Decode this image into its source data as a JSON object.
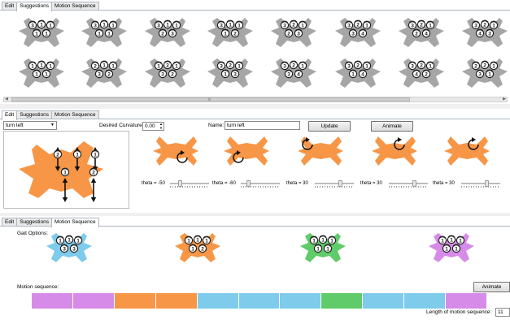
{
  "colors": {
    "gray": "#a6a6a6",
    "orange": "#f79646",
    "blue": "#7ecbec",
    "green": "#60cb6a",
    "purple": "#d78be8",
    "badge": "#222222"
  },
  "suggestions_panel": {
    "tabs": [
      {
        "label": "Edit",
        "active": false
      },
      {
        "label": "Suggestions",
        "active": true
      },
      {
        "label": "Motion Sequence",
        "active": false
      }
    ],
    "robots": [
      {
        "badges": [
          "3",
          "1",
          "1",
          "1",
          "1"
        ]
      },
      {
        "badges": [
          "3",
          "1",
          "1",
          "1",
          "1"
        ]
      },
      {
        "badges": [
          "3",
          "1",
          "1",
          "2",
          "3"
        ]
      },
      {
        "badges": [
          "3",
          "1",
          "1",
          "1",
          "2"
        ]
      },
      {
        "badges": [
          "3",
          "2",
          "1",
          "2",
          "3"
        ]
      },
      {
        "badges": [
          "3",
          "2",
          "1",
          "3",
          "4"
        ]
      },
      {
        "badges": [
          "3",
          "2",
          "1",
          "2",
          "4"
        ]
      },
      {
        "badges": [
          "3",
          "2",
          "1",
          "4",
          "3"
        ]
      },
      {
        "badges": [
          "1",
          "1",
          "1",
          "1",
          "1"
        ]
      },
      {
        "badges": [
          "2",
          "1",
          "1",
          "3",
          "2"
        ]
      },
      {
        "badges": [
          "1",
          "2",
          "1",
          "3",
          "2"
        ]
      },
      {
        "badges": [
          "3",
          "2",
          "1",
          "1",
          "3"
        ]
      },
      {
        "badges": [
          "3",
          "2",
          "1",
          "3",
          "4"
        ]
      },
      {
        "badges": [
          "3",
          "2",
          "1",
          "1",
          "4"
        ]
      },
      {
        "badges": [
          "3",
          "2",
          "1",
          "4",
          "2"
        ]
      },
      {
        "badges": [
          "2",
          "2",
          "1",
          "3",
          "1"
        ]
      }
    ]
  },
  "edit_panel": {
    "tabs": [
      {
        "label": "Edit",
        "active": true
      },
      {
        "label": "Suggestions",
        "active": false
      },
      {
        "label": "Motion Sequence",
        "active": false
      }
    ],
    "gait_select": "turn left",
    "curvature_label": "Desired Curvature:",
    "curvature_value": "0.00",
    "name_label": "Name:",
    "name_value": "turn left",
    "update_label": "Update",
    "animate_label": "Animate",
    "big_robot_badges": [
      "2",
      "1",
      "1",
      "1",
      "2"
    ],
    "frames": [
      {
        "theta_label": "theta = -50",
        "theta": -50
      },
      {
        "theta_label": "theta = -60",
        "theta": -60
      },
      {
        "theta_label": "theta = 30",
        "theta": 30
      },
      {
        "theta_label": "theta = 30",
        "theta": 30
      },
      {
        "theta_label": "theta = 30",
        "theta": 30
      }
    ]
  },
  "motion_panel": {
    "tabs": [
      {
        "label": "Edit",
        "active": false
      },
      {
        "label": "Suggestions",
        "active": false
      },
      {
        "label": "Motion Sequence",
        "active": true
      }
    ],
    "gait_options_label": "Gait Options:",
    "gaits": [
      {
        "color": "blue",
        "badges": [
          "1",
          "1",
          "1",
          "3",
          "3"
        ]
      },
      {
        "color": "orange",
        "badges": [
          "1",
          "1",
          "1",
          "1",
          "2"
        ]
      },
      {
        "color": "green",
        "badges": [
          "1",
          "1",
          "1",
          "1",
          "1"
        ]
      },
      {
        "color": "purple",
        "badges": [
          "1",
          "1",
          "1",
          "1",
          "1"
        ]
      }
    ],
    "motion_sequence_label": "Motion sequence:",
    "animate_label": "Animate",
    "sequence": [
      "purple",
      "purple",
      "orange",
      "orange",
      "blue",
      "blue",
      "blue",
      "green",
      "blue",
      "blue",
      "purple"
    ],
    "length_label": "Length of motion sequence:",
    "length_value": "11"
  }
}
